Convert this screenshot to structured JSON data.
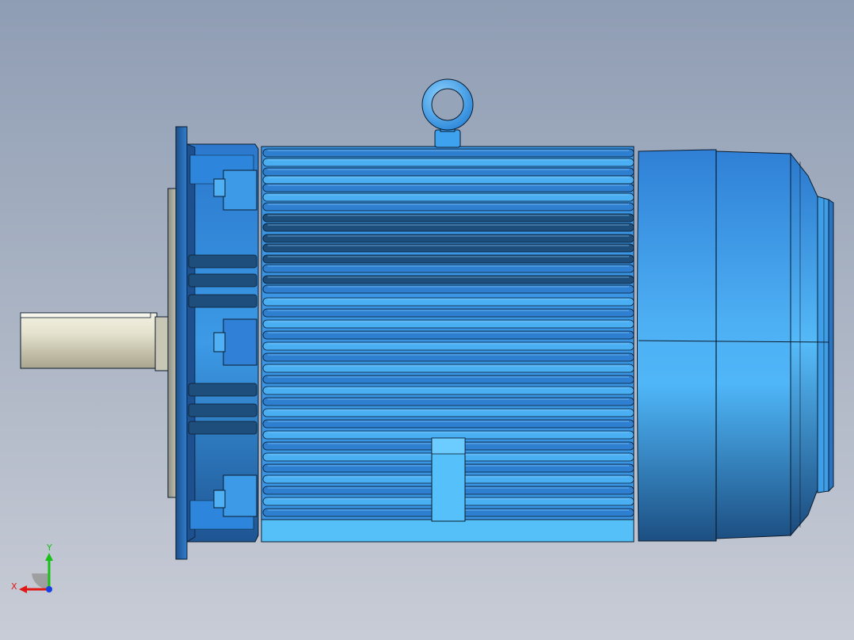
{
  "viewport": {
    "background_top": "#8f9db4",
    "background_bottom": "#c8ccd6"
  },
  "model": {
    "body_color": "#4ca8f0",
    "body_dark": "#1e4e7c",
    "body_mid": "#2f7fd0",
    "shaft_color": "#dedbc6",
    "edge_color": "#0b1c2e",
    "parts": [
      "eye-bolt",
      "flange",
      "front-end-cap",
      "ribbed-frame",
      "fan-cover",
      "shaft",
      "terminal-foot"
    ]
  },
  "triad": {
    "x_label": "X",
    "y_label": "Y",
    "x_color": "#e01818",
    "y_color": "#18c018",
    "z_color": "#1840e0"
  }
}
